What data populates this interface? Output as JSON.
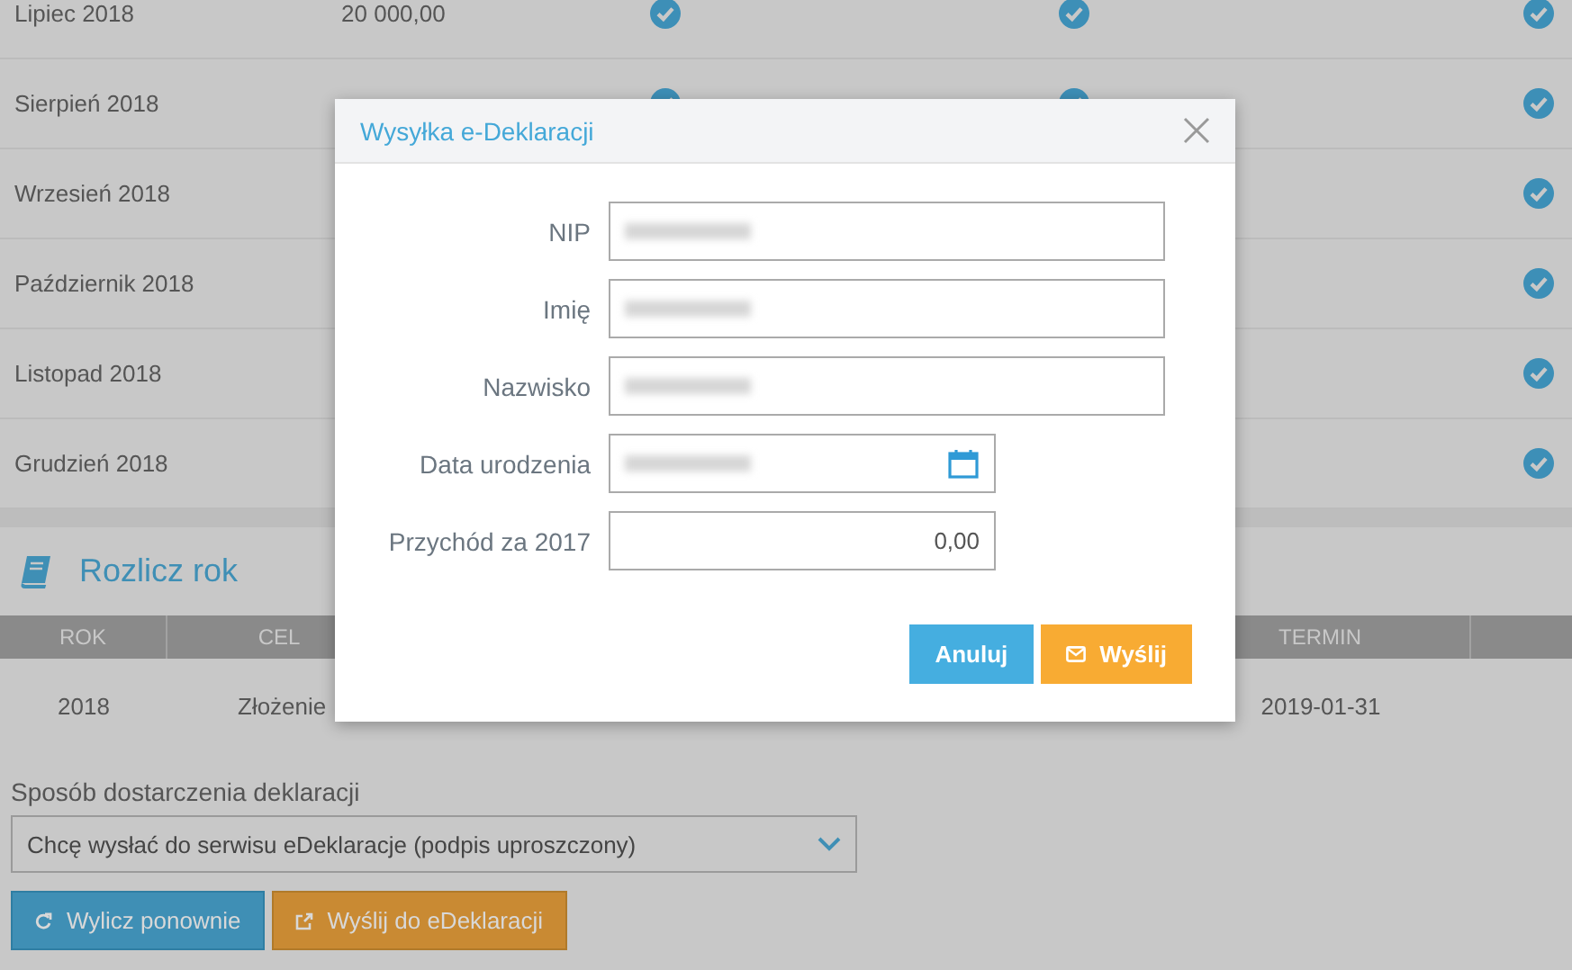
{
  "months": {
    "rows": [
      {
        "month": "Lipiec 2018",
        "amount": "20 000,00",
        "check_1": true,
        "check_2": true,
        "check_3": true
      },
      {
        "month": "Sierpień 2018",
        "check_1": true,
        "check_2": true,
        "check_3": true
      },
      {
        "month": "Wrzesień 2018",
        "check_3": true
      },
      {
        "month": "Październik 2018",
        "check_3": true
      },
      {
        "month": "Listopad 2018",
        "check_3": true
      },
      {
        "month": "Grudzień 2018",
        "check_3": true
      }
    ]
  },
  "annual": {
    "title": "Rozlicz rok",
    "columns": [
      "ROK",
      "CEL",
      "TERMIN"
    ],
    "row": [
      "2018",
      "Złożenie",
      "2019-01-31"
    ]
  },
  "delivery": {
    "label": "Sposób dostarczenia deklaracji",
    "value": "Chcę wysłać do serwisu eDeklaracje (podpis uproszczony)",
    "buttons": [
      {
        "label": "Wylicz ponownie",
        "kind": "recalculate"
      },
      {
        "label": "Wyślij do eDeklaracji",
        "kind": "external"
      }
    ]
  },
  "dialog": {
    "title": "Wysyłka e-Deklaracji",
    "fields": [
      {
        "label": "NIP",
        "kind": "text",
        "blurred": true
      },
      {
        "label": "Imię",
        "kind": "text",
        "blurred": true
      },
      {
        "label": "Nazwisko",
        "kind": "text",
        "blurred": true
      },
      {
        "label": "Data urodzenia",
        "kind": "date",
        "blurred": true
      },
      {
        "label": "Przychód za 2017",
        "kind": "amount",
        "value": "0,00"
      }
    ],
    "buttons": [
      {
        "label": "Anuluj",
        "kind": "cancel"
      },
      {
        "label": "Wyślij",
        "kind": "send"
      }
    ]
  }
}
